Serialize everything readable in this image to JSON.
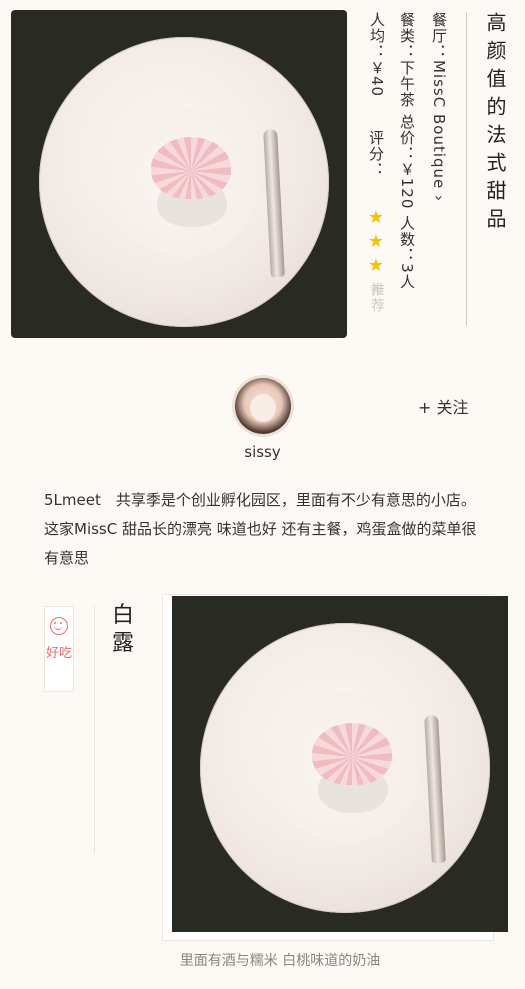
{
  "header": {
    "title": "高颜值的法式甜品",
    "restaurant_line": "餐厅：MissC Boutique ›",
    "category_line": "餐类：下午茶  总价：￥120  人数：3人",
    "per_person_line": "人均：￥40",
    "rating_label": "评分：",
    "rating": 3,
    "rating_max": 4,
    "recommend_label": "推荐",
    "star_color": "#f5c400"
  },
  "author": {
    "name": "sissy",
    "follow_label": "+ 关注"
  },
  "post": {
    "description": "5Lmeet　共享季是个创业孵化园区，里面有不少有意思的小店。 这家MissC 甜品长的漂亮 味道也好 还有主餐，鸡蛋盒做的菜单很有意思"
  },
  "dish": {
    "tag_label": "好吃",
    "tag_color": "#e86f6f",
    "name": "白露",
    "caption": "里面有酒与糯米 白桃味道的奶油"
  }
}
